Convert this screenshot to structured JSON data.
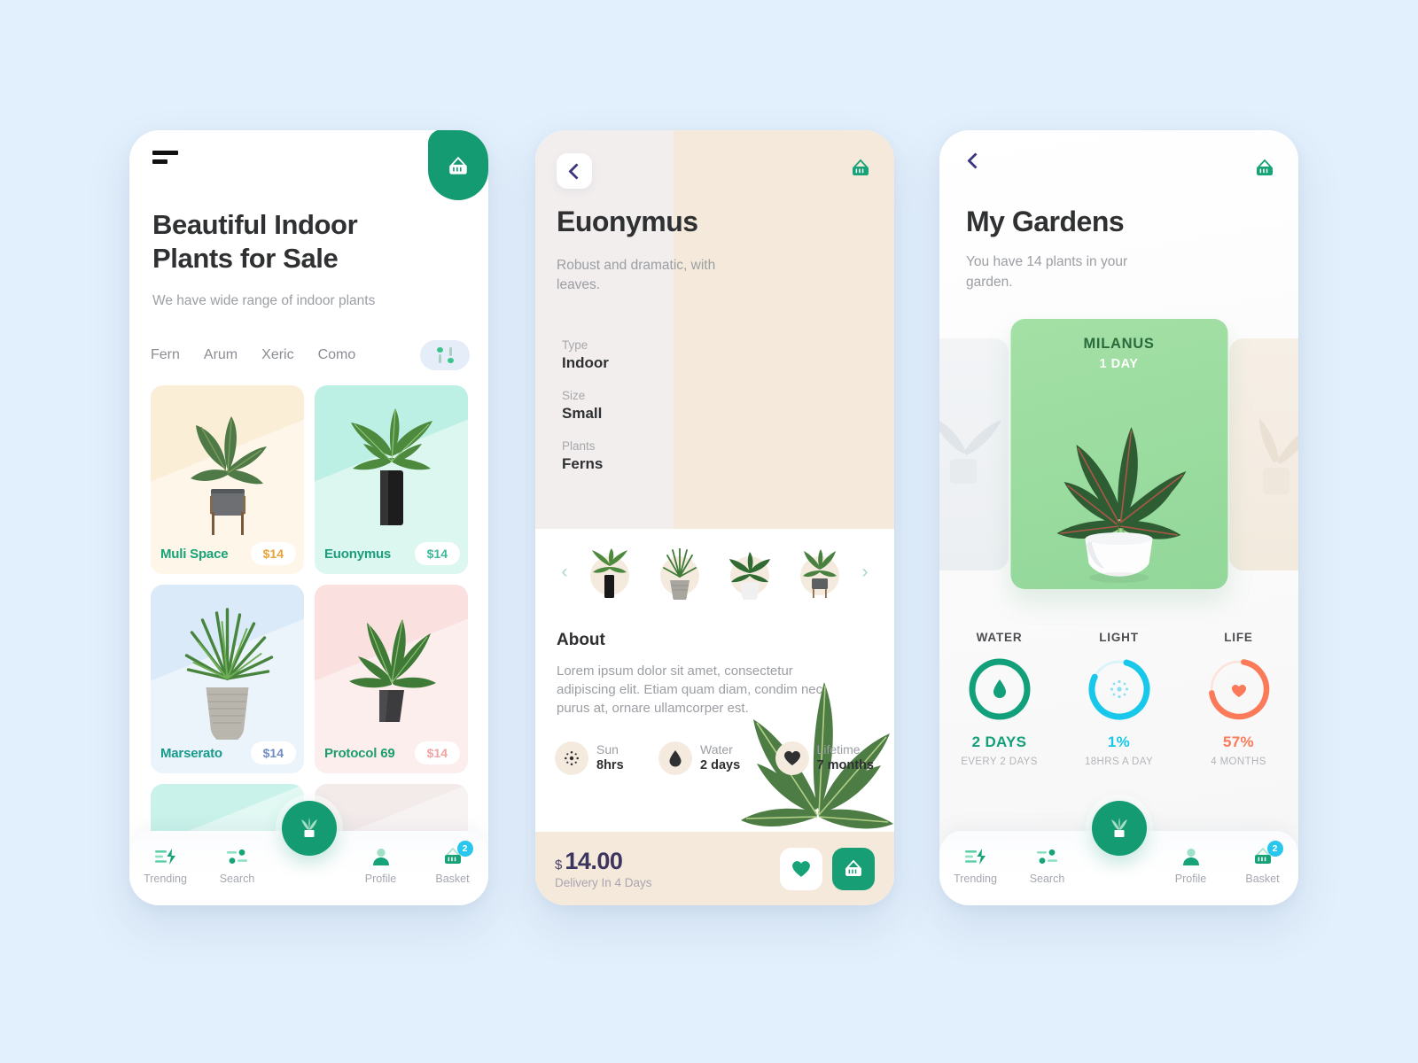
{
  "background_color": "#e2effc",
  "screen1": {
    "menu_icon": "hamburger-icon",
    "cart_icon": "basket-icon",
    "title": "Beautiful Indoor Plants for Sale",
    "title_line1": "Beautiful Indoor",
    "title_line2": "Plants for Sale",
    "subtitle": "We have wide range of indoor plants",
    "tabs": [
      {
        "label": "Fern"
      },
      {
        "label": "Arum"
      },
      {
        "label": "Xeric"
      },
      {
        "label": "Como"
      }
    ],
    "filter_button": "filter-icon",
    "products": [
      {
        "name": "Muli Space",
        "price": "$14",
        "bg": "#fbeed7",
        "name_color": "#18a277",
        "price_color": "#e8a23a"
      },
      {
        "name": "Euonymus",
        "price": "$14",
        "bg": "#bdf0e4",
        "name_color": "#1d9d7c",
        "price_color": "#3fb79a"
      },
      {
        "name": "Marserato",
        "price": "$14",
        "bg": "#dbeaf8",
        "name_color": "#169a8a",
        "price_color": "#6f8cc4"
      },
      {
        "name": "Protocol 69",
        "price": "$14",
        "bg": "#fbe0e0",
        "name_color": "#1d9d6e",
        "price_color": "#f0a3a0"
      },
      {
        "name": "",
        "price": "",
        "bg": "#c8f2ea",
        "name_color": "#1d9d7c",
        "price_color": "#3fb79a"
      },
      {
        "name": "",
        "price": "",
        "bg": "#f3eaea",
        "name_color": "#1d9d7c",
        "price_color": "#3fb79a"
      }
    ],
    "fab_icon": "plant-icon",
    "nav": [
      {
        "label": "Trending",
        "icon": "trending-icon"
      },
      {
        "label": "Search",
        "icon": "search-icon"
      },
      {
        "label": "Profile",
        "icon": "profile-icon"
      },
      {
        "label": "Basket",
        "icon": "basket-icon",
        "badge": "2"
      }
    ]
  },
  "screen2": {
    "back_icon": "chevron-left-icon",
    "cart_icon": "basket-icon",
    "title": "Euonymus",
    "description": "Robust and dramatic, with leaves.",
    "specs": [
      {
        "key": "Type",
        "value": "Indoor"
      },
      {
        "key": "Size",
        "value": "Small"
      },
      {
        "key": "Plants",
        "value": "Ferns"
      }
    ],
    "carousel": {
      "prev_icon": "chevron-left-icon",
      "next_icon": "chevron-right-icon",
      "thumb_count": 4
    },
    "about_heading": "About",
    "about_text": "Lorem ipsum dolor sit amet, consectetur adipiscing elit. Etiam quam diam, condim nec purus at, ornare ullamcorper est.",
    "attributes": [
      {
        "icon": "sun-icon",
        "label": "Sun",
        "value": "8hrs"
      },
      {
        "icon": "water-icon",
        "label": "Water",
        "value": "2 days"
      },
      {
        "icon": "heart-icon",
        "label": "Lifetime",
        "value": "7 months"
      }
    ],
    "currency": "$",
    "price": "14.00",
    "delivery": "Delivery In 4 Days",
    "favorite_icon": "heart-icon",
    "add_to_cart_icon": "basket-icon"
  },
  "screen3": {
    "back_icon": "chevron-left-icon",
    "cart_icon": "basket-icon",
    "title": "My Gardens",
    "subtitle": "You have 14 plants in your garden.",
    "card": {
      "name": "MILANUS",
      "days": "1 DAY"
    },
    "metrics": [
      {
        "title": "WATER",
        "icon": "water-drop-icon",
        "value": "2 DAYS",
        "note": "EVERY 2 DAYS",
        "color": "#11a07a",
        "percent": 100
      },
      {
        "title": "LIGHT",
        "icon": "sun-icon",
        "value": "1%",
        "note": "18HRS A DAY",
        "color": "#17c8ea",
        "percent": 78
      },
      {
        "title": "LIFE",
        "icon": "heart-icon",
        "value": "57%",
        "note": "4 MONTHS",
        "color": "#fa7a5a",
        "percent": 70
      }
    ],
    "fab_icon": "plant-icon",
    "nav": [
      {
        "label": "Trending",
        "icon": "trending-icon"
      },
      {
        "label": "Search",
        "icon": "search-icon"
      },
      {
        "label": "Profile",
        "icon": "profile-icon"
      },
      {
        "label": "Basket",
        "icon": "basket-icon",
        "badge": "2"
      }
    ]
  }
}
